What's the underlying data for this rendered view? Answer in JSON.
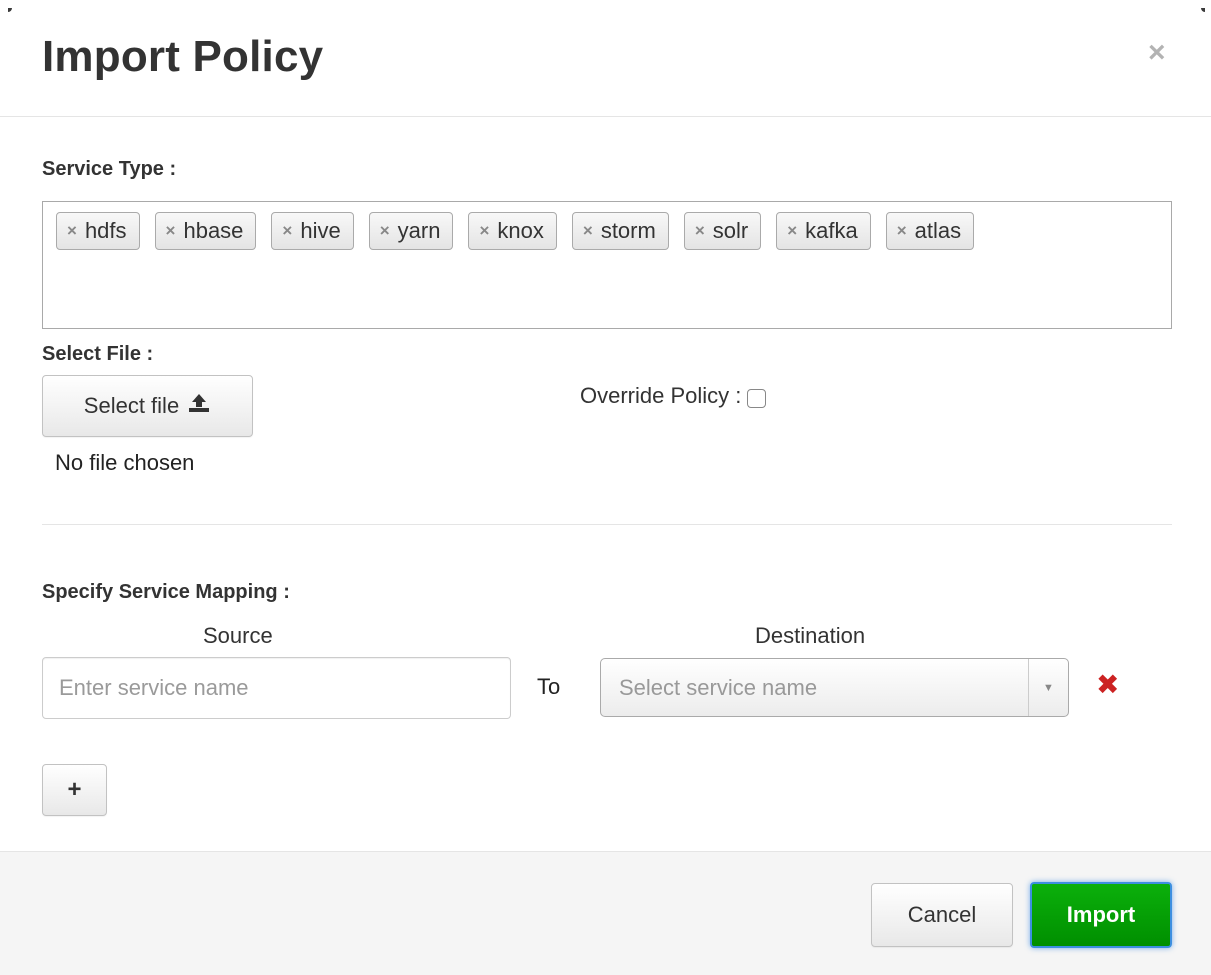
{
  "dialog": {
    "title": "Import Policy",
    "close_icon": "close-icon"
  },
  "service_type": {
    "label": "Service Type :",
    "tags": [
      "hdfs",
      "hbase",
      "hive",
      "yarn",
      "knox",
      "storm",
      "solr",
      "kafka",
      "atlas"
    ],
    "remove_glyph": "×"
  },
  "select_file": {
    "label": "Select File :",
    "button_label": "Select file",
    "button_icon": "upload-icon",
    "status": "No file chosen"
  },
  "override": {
    "label": "Override Policy :",
    "checked": false
  },
  "mapping": {
    "label": "Specify Service Mapping :",
    "source_header": "Source",
    "destination_header": "Destination",
    "source_placeholder": "Enter service name",
    "to_label": "To",
    "destination_placeholder": "Select service name",
    "add_label": "+"
  },
  "footer": {
    "cancel_label": "Cancel",
    "import_label": "Import"
  },
  "colors": {
    "import_button": "#009900",
    "remove_icon": "#cc2222",
    "focus_ring": "#3d8fe0"
  }
}
